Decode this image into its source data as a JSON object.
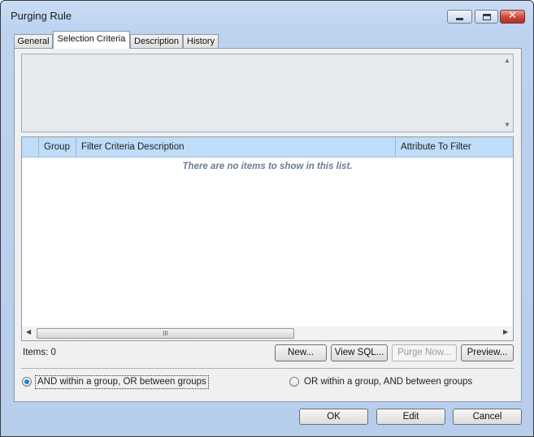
{
  "window": {
    "title": "Purging Rule",
    "controls": {
      "minimize": "minimize",
      "maximize": "maximize",
      "close": "✕"
    }
  },
  "tabs": [
    {
      "label": "General"
    },
    {
      "label": "Selection Criteria",
      "active": true
    },
    {
      "label": "Description"
    },
    {
      "label": "History"
    }
  ],
  "sql_box": {
    "value": ""
  },
  "list": {
    "columns": [
      "",
      "Group",
      "Filter Criteria Description",
      "Attribute To Filter"
    ],
    "empty_message": "There are no items to show in this list.",
    "scroll_thumb_glyph": "III"
  },
  "items_count": "Items: 0",
  "buttons": {
    "new": "New...",
    "view_sql": "View SQL...",
    "purge_now": "Purge Now...",
    "preview": "Preview..."
  },
  "radios": {
    "and_within": {
      "label": "AND within a group, OR between groups",
      "checked": true
    },
    "or_within": {
      "label": "OR within a group, AND between groups",
      "checked": false
    }
  },
  "footer": {
    "ok": "OK",
    "edit": "Edit",
    "cancel": "Cancel"
  },
  "colors": {
    "accent": "#2a7fd4",
    "header": "#bfdcf8",
    "empty_text": "#6b7c92"
  }
}
